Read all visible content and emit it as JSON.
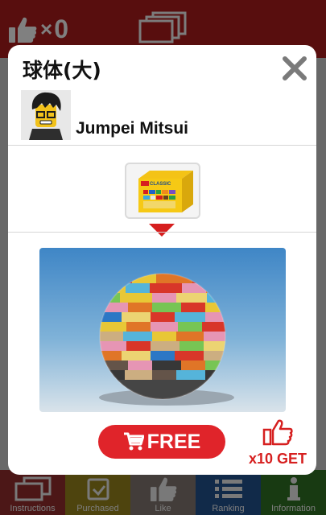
{
  "header": {
    "likes_times": "×",
    "likes_count": "0"
  },
  "bottom_nav": [
    {
      "label": "Instructions",
      "icon": "stacked-cards-icon",
      "color": "#8b2b2b"
    },
    {
      "label": "Purchased",
      "icon": "folder-hand-icon",
      "color": "#8f7d1a"
    },
    {
      "label": "Like",
      "icon": "thumbs-up-icon",
      "color": "#7b6f6a"
    },
    {
      "label": "Ranking",
      "icon": "list-icon",
      "color": "#1f4d86"
    },
    {
      "label": "Information",
      "icon": "info-icon",
      "color": "#2d6b22"
    }
  ],
  "modal": {
    "title": "球体(大)",
    "author_name": "Jumpei Mitsui",
    "free_label": "FREE",
    "reward_label": "x10 GET",
    "set_box_text": "CLASSIC"
  },
  "colors": {
    "accent_red": "#e0242a",
    "header_red": "#a01b1b"
  }
}
